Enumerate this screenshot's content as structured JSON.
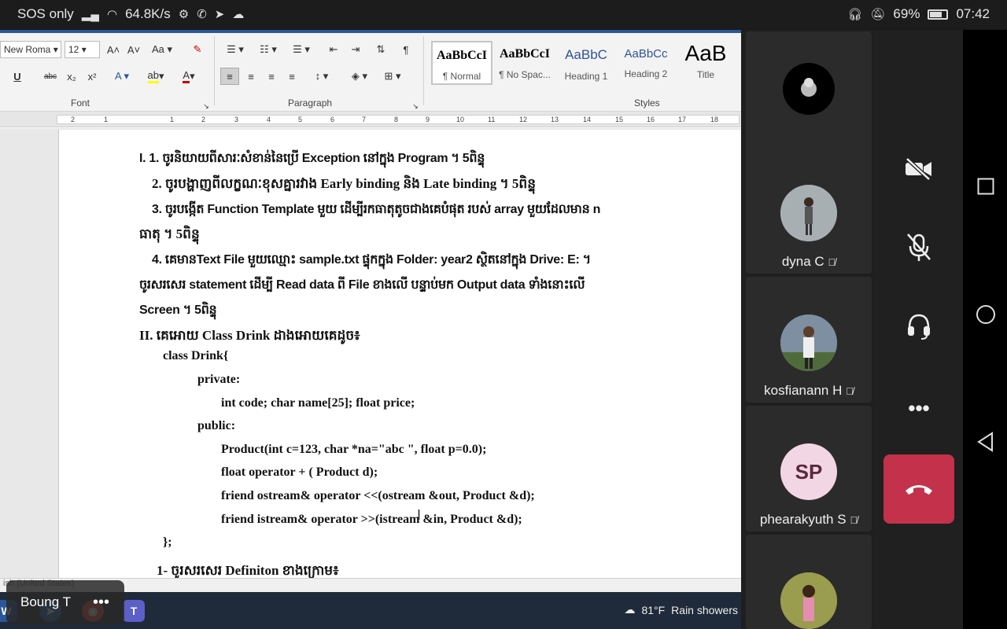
{
  "status_bar": {
    "carrier": "SOS only",
    "speed": "64.8K/s",
    "battery": "69%",
    "time": "07:42"
  },
  "ribbon": {
    "font_name": "New Roma",
    "font_size": "12",
    "font_group": "Font",
    "paragraph_group": "Paragraph",
    "styles_group": "Styles",
    "styles": [
      {
        "sample": "AaBbCcI",
        "name": "¶ Normal"
      },
      {
        "sample": "AaBbCcI",
        "name": "¶ No Spac..."
      },
      {
        "sample": "AaBbC",
        "name": "Heading 1"
      },
      {
        "sample": "AaBbCc",
        "name": "Heading 2"
      },
      {
        "sample": "AaB",
        "name": "Title"
      }
    ],
    "ruler_numbers": [
      "2",
      "1",
      "1",
      "2",
      "3",
      "4",
      "5",
      "6",
      "7",
      "8",
      "9",
      "10",
      "11",
      "12",
      "13",
      "14",
      "15",
      "16",
      "17",
      "18"
    ]
  },
  "document": {
    "lines": [
      "I. 1. ចូរនិយាយពីសារៈសំខាន់នៃប្រើ Exception នៅក្នុង Program ។    5ពិន្ទុ",
      "2. ចូរបង្ហាញពីលក្ខណៈខុសគ្នារវាង Early binding និង Late binding ។   5ពិន្ទុ",
      "3. ចូរបង្កើត Function Template មួយ ដើម្បីរកធាតុតូចជាងគេបំផុត របស់ array មួយដែលមាន n",
      "ធាតុ  ។    5ពិន្ទុ",
      "4. គេមានText File មួយឈ្មោះ sample.txt ផ្ទុកក្នុង Folder: year2 ស្ថិតនៅក្នុង Drive: E: ។",
      "ចូរសរសេរ statement ដើម្បី Read data ពី File ខាងលើ បន្ទាប់មក Output data ទាំងនោះលើ",
      "Screen ។    5ពិន្ទុ",
      "II. គេអោយ Class Drink ដាងអោយគេដូច៖",
      "class  Drink{",
      "private:",
      "int  code;  char  name[25];  float  price;",
      "public:",
      "Product(int c=123, char *na=\"abc \",  float  p=0.0);",
      "float  operator + ( Product  d);",
      "friend  ostream&  operator <<(ostream  &out, Product  &d);",
      "friend  istream&  operator >>(istream  &in, Product  &d);",
      "};",
      "1- ចូរសរសេរ Definiton ខាងក្រោម៖"
    ]
  },
  "window_status": "ish (United States)",
  "taskbar": {
    "weather_temp": "81°F",
    "weather_text": "Rain showers"
  },
  "presenter": {
    "name": "Boung T",
    "more": "•••"
  },
  "participants": [
    {
      "name": "dyna C",
      "initials": ""
    },
    {
      "name": "kosfianann H",
      "initials": ""
    },
    {
      "name": "phearakyuth S",
      "initials": "SP"
    }
  ],
  "controls": {
    "more": "•••"
  },
  "colors": {
    "leave_red": "#c4314b",
    "word_blue": "#2b579a",
    "avatar_pink": "#f3d6e3"
  }
}
